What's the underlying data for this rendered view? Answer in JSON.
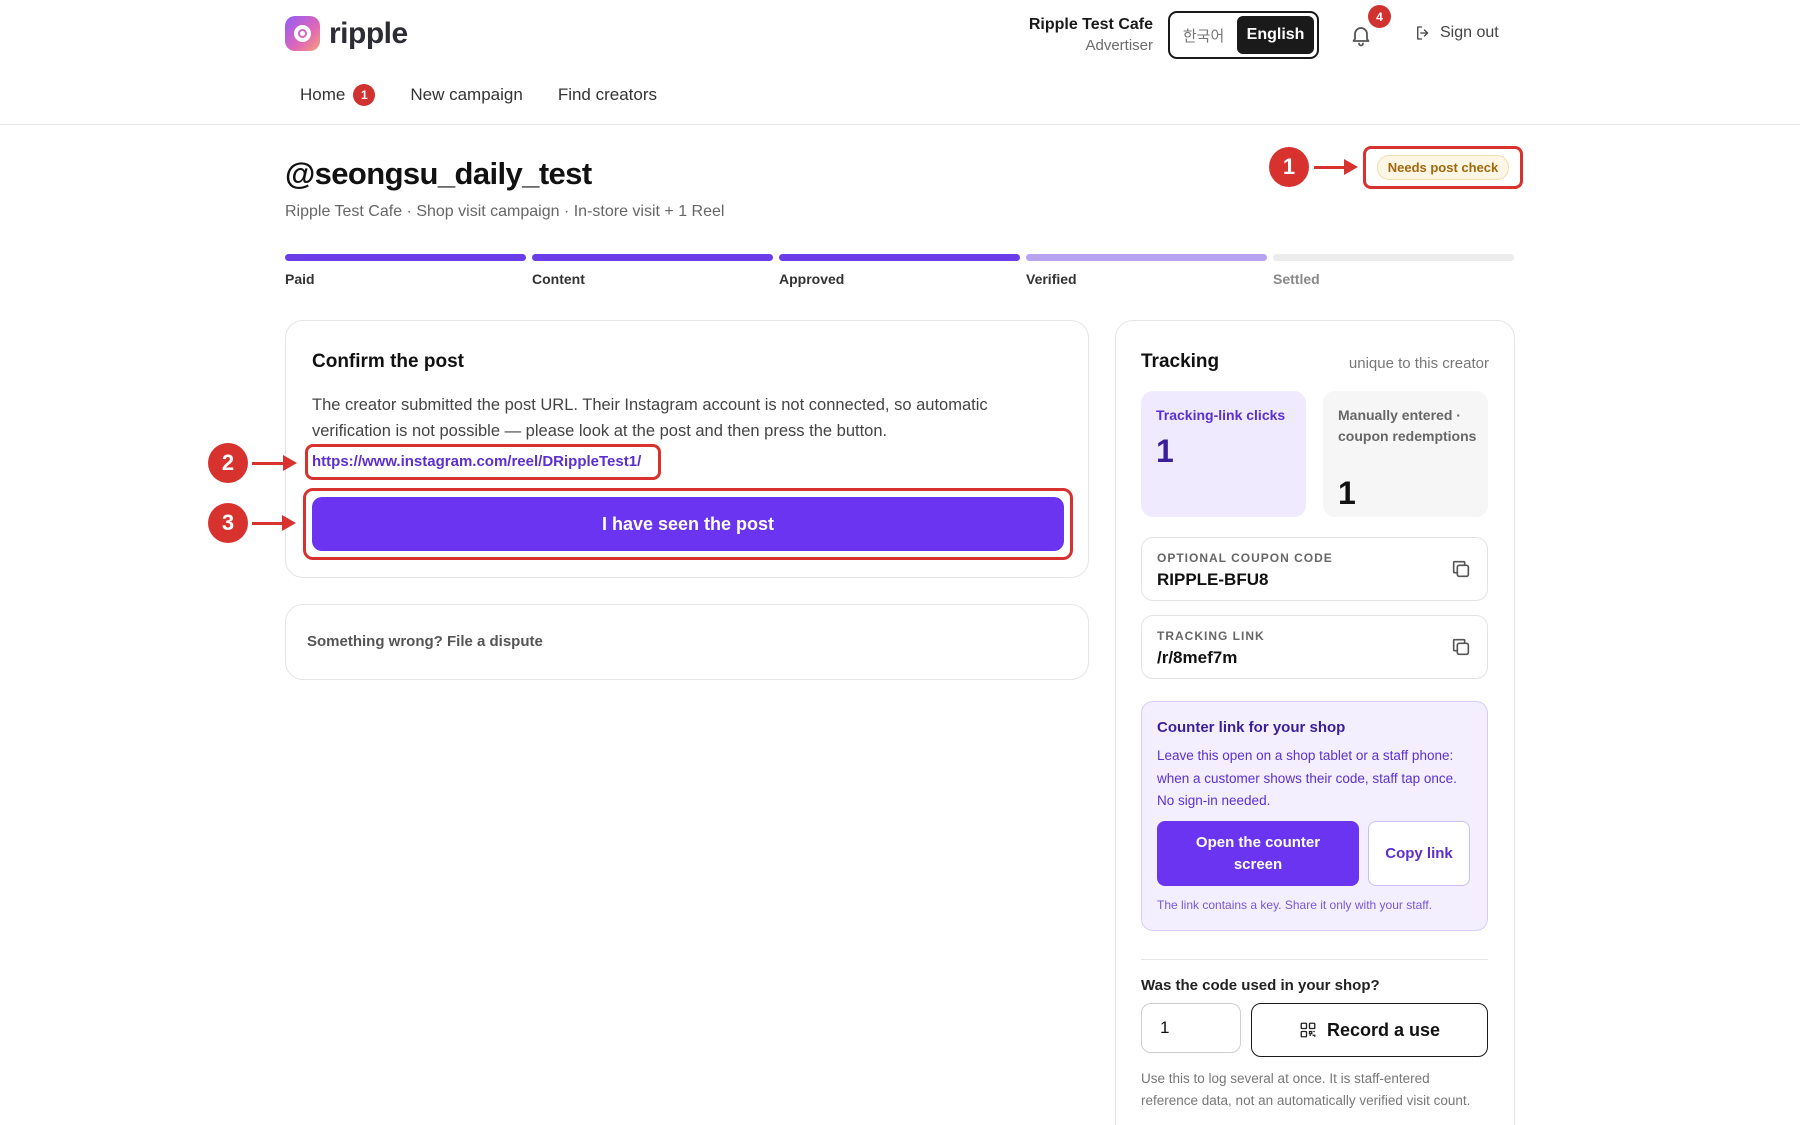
{
  "brand": {
    "name": "ripple"
  },
  "account": {
    "name": "Ripple Test Cafe",
    "role": "Advertiser"
  },
  "language": {
    "korean": "한국어",
    "english": "English",
    "selected": "English"
  },
  "notifications": {
    "count": "4"
  },
  "header": {
    "sign_out": "Sign out"
  },
  "nav": {
    "home": "Home",
    "home_badge": "1",
    "new_campaign": "New campaign",
    "find_creators": "Find creators"
  },
  "page": {
    "title": "@seongsu_daily_test",
    "subtitle": "Ripple Test Cafe · Shop visit campaign · In-store visit + 1 Reel",
    "status": "Needs post check"
  },
  "annotations": [
    "1",
    "2",
    "3"
  ],
  "progress": {
    "steps": [
      {
        "label": "Paid",
        "state": "done"
      },
      {
        "label": "Content",
        "state": "done"
      },
      {
        "label": "Approved",
        "state": "done"
      },
      {
        "label": "Verified",
        "state": "partial"
      },
      {
        "label": "Settled",
        "state": "todo"
      }
    ]
  },
  "confirm": {
    "title": "Confirm the post",
    "text": "The creator submitted the post URL. Their Instagram account is not connected, so automatic verification is not possible — please look at the post and then press the button.",
    "post_url": "https://www.instagram.com/reel/DRippleTest1/",
    "button": "I have seen the post"
  },
  "dispute": {
    "text": "Something wrong? File a dispute"
  },
  "tracking": {
    "title": "Tracking",
    "subtitle": "unique to this creator",
    "clicks_label": "Tracking-link clicks",
    "clicks_value": "1",
    "coupon_label": "Manually entered · coupon redemptions",
    "coupon_value": "1",
    "coupon_code_label": "OPTIONAL COUPON CODE",
    "coupon_code": "RIPPLE-BFU8",
    "tracking_link_label": "TRACKING LINK",
    "tracking_link": "/r/8mef7m"
  },
  "counter": {
    "title": "Counter link for your shop",
    "text": "Leave this open on a shop tablet or a staff phone: when a customer shows their code, staff tap once. No sign-in needed.",
    "open_button": "Open the counter screen",
    "copy_button": "Copy link",
    "note": "The link contains a key. Share it only with your staff."
  },
  "record": {
    "question": "Was the code used in your shop?",
    "quantity": "1",
    "button": "Record a use",
    "note": "Use this to log several at once. It is staff-entered reference data, not an automatically verified visit count."
  },
  "colors": {
    "accent": "#6a34f0",
    "annotation": "#d8322f",
    "badge": "#d0322f",
    "status_bg": "#fdf6e4",
    "status_text": "#a1680c"
  },
  "icons": [
    "bell-icon",
    "sign-out-icon",
    "copy-icon",
    "qr-code-icon"
  ]
}
